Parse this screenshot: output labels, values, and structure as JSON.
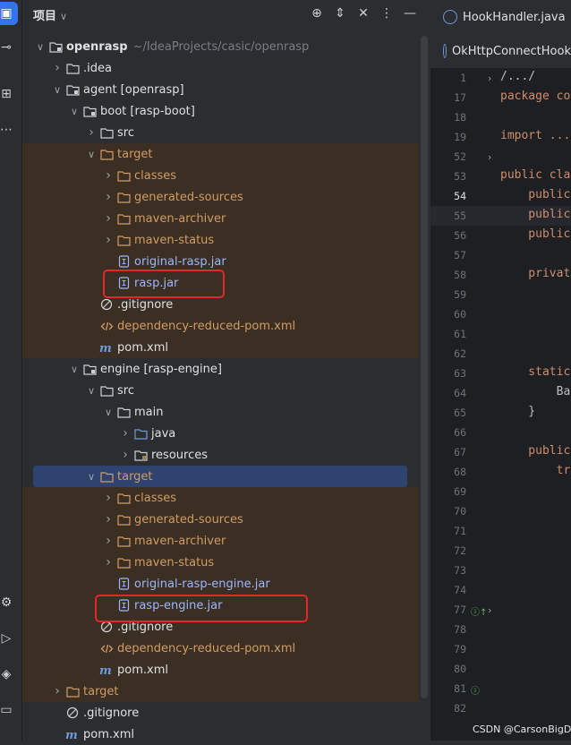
{
  "panel": {
    "title": "项目",
    "chevron": "∨"
  },
  "tree": [
    {
      "label": "openrasp",
      "suffix": "~/IdeaProjects/casic/openrasp",
      "icon": "module-folder-icon",
      "bold": true
    },
    {
      "label": ".idea",
      "icon": "folder-icon"
    },
    {
      "label": "agent [openrasp]",
      "icon": "module-folder-icon"
    },
    {
      "label": "boot [rasp-boot]",
      "icon": "module-folder-icon"
    },
    {
      "label": "src",
      "icon": "folder-icon"
    },
    {
      "label": "target",
      "icon": "folder-orange-icon"
    },
    {
      "label": "classes",
      "icon": "folder-orange-icon"
    },
    {
      "label": "generated-sources",
      "icon": "folder-orange-icon"
    },
    {
      "label": "maven-archiver",
      "icon": "folder-orange-icon"
    },
    {
      "label": "maven-status",
      "icon": "folder-orange-icon"
    },
    {
      "label": "original-rasp.jar",
      "icon": "jar-icon"
    },
    {
      "label": "rasp.jar",
      "icon": "jar-icon"
    },
    {
      "label": ".gitignore",
      "icon": "ignore-icon"
    },
    {
      "label": "dependency-reduced-pom.xml",
      "icon": "xml-icon"
    },
    {
      "label": "pom.xml",
      "icon": "maven-icon"
    },
    {
      "label": "engine [rasp-engine]",
      "icon": "module-folder-icon"
    },
    {
      "label": "src",
      "icon": "folder-icon"
    },
    {
      "label": "main",
      "icon": "folder-icon"
    },
    {
      "label": "java",
      "icon": "source-folder-icon"
    },
    {
      "label": "resources",
      "icon": "resources-folder-icon"
    },
    {
      "label": "target",
      "icon": "folder-orange-icon"
    },
    {
      "label": "classes",
      "icon": "folder-orange-icon"
    },
    {
      "label": "generated-sources",
      "icon": "folder-orange-icon"
    },
    {
      "label": "maven-archiver",
      "icon": "folder-orange-icon"
    },
    {
      "label": "maven-status",
      "icon": "folder-orange-icon"
    },
    {
      "label": "original-rasp-engine.jar",
      "icon": "jar-icon"
    },
    {
      "label": "rasp-engine.jar",
      "icon": "jar-icon"
    },
    {
      "label": ".gitignore",
      "icon": "ignore-icon"
    },
    {
      "label": "dependency-reduced-pom.xml",
      "icon": "xml-icon"
    },
    {
      "label": "pom.xml",
      "icon": "maven-icon"
    },
    {
      "label": "target",
      "icon": "folder-orange-icon"
    },
    {
      "label": ".gitignore",
      "icon": "ignore-icon"
    },
    {
      "label": "pom.xml",
      "icon": "maven-icon"
    }
  ],
  "editor": {
    "tabs": [
      "HookHandler.java",
      "OkHttpConnectHook"
    ],
    "line_numbers": [
      "1",
      "17",
      "18",
      "19",
      "52",
      "53",
      "54",
      "55",
      "56",
      "57",
      "58",
      "59",
      "60",
      "61",
      "62",
      "63",
      "64",
      "65",
      "66",
      "67",
      "68",
      "69",
      "70",
      "71",
      "72",
      "73",
      "74",
      "77",
      "78",
      "79",
      "80",
      "81",
      "82"
    ],
    "code_lines": [
      {
        "line": "1",
        "text": "/.../",
        "kind": "id"
      },
      {
        "line": "17",
        "text": "package co",
        "kind": "kw"
      },
      {
        "line": "19",
        "text": "import ...",
        "kind": "kw"
      },
      {
        "line": "53",
        "text": "public cla",
        "kind": "kw"
      },
      {
        "line": "54",
        "text": "    public",
        "kind": "kw"
      },
      {
        "line": "55",
        "text": "    public",
        "kind": "kw"
      },
      {
        "line": "56",
        "text": "    public",
        "kind": "kw"
      },
      {
        "line": "58",
        "text": "    privat",
        "kind": "kw"
      },
      {
        "line": "63",
        "text": "    static",
        "kind": "kw"
      },
      {
        "line": "64",
        "text": "        Ba",
        "kind": "id"
      },
      {
        "line": "65",
        "text": "    }",
        "kind": "id"
      },
      {
        "line": "67",
        "text": "    public",
        "kind": "kw"
      },
      {
        "line": "68",
        "text": "        tr",
        "kind": "kw"
      }
    ]
  },
  "watermark": "CSDN @CarsonBigData",
  "colors": {
    "highlight_box": "#e5262b",
    "selection": "#2e436e",
    "excluded": "#3a2f22"
  }
}
